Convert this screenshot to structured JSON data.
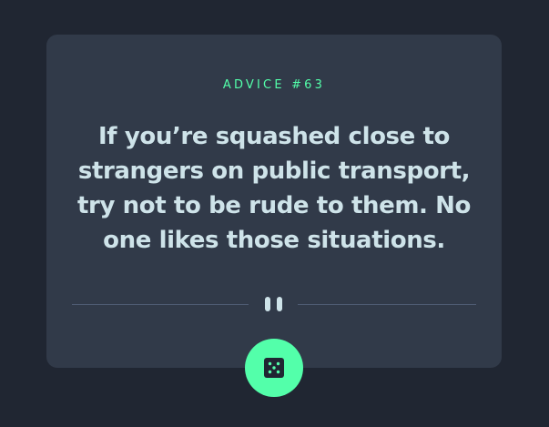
{
  "advice": {
    "id_label": "ADVICE #63",
    "text": "If you’re squashed close to strangers on public transport, try not to be rude to them. No one likes those situations."
  },
  "colors": {
    "background": "#202632",
    "card": "#313A49",
    "accent": "#53FFAA",
    "text": "#CEE3E9",
    "divider": "#4F5D74"
  },
  "icons": {
    "divider_icon": "pause-icon",
    "button_icon": "dice-icon"
  }
}
